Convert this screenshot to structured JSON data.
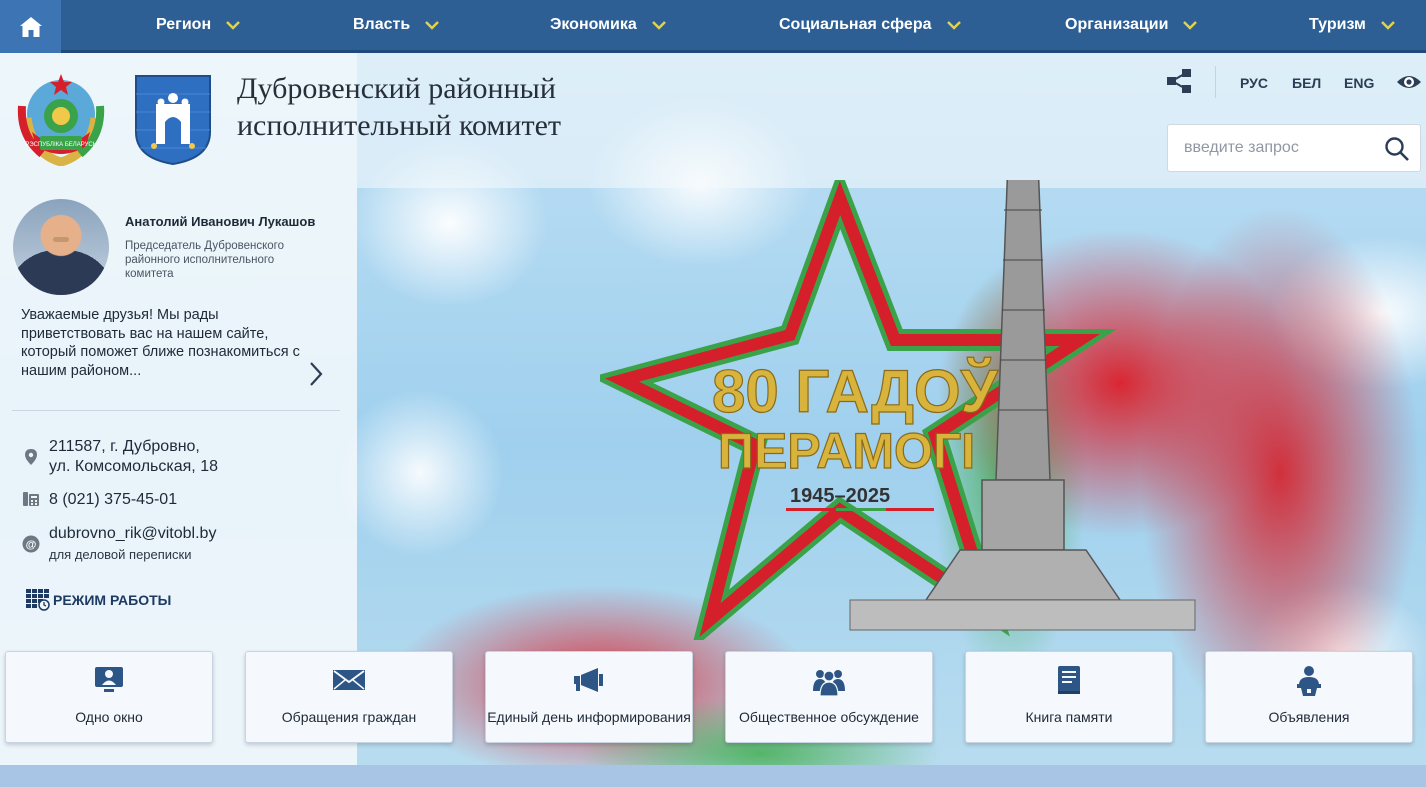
{
  "nav": {
    "items": [
      {
        "label": "Регион"
      },
      {
        "label": "Власть"
      },
      {
        "label": "Экономика"
      },
      {
        "label": "Социальная сфера"
      },
      {
        "label": "Организации"
      },
      {
        "label": "Туризм"
      }
    ]
  },
  "header": {
    "title_line1": "Дубровенский районный",
    "title_line2": "исполнительный комитет",
    "emblem_text": "РЭСПУБЛІКА БЕЛАРУСЬ",
    "languages": [
      "РУС",
      "БЕЛ",
      "ENG"
    ],
    "search_placeholder": "введите запрос"
  },
  "chairman": {
    "name": "Анатолий Иванович Лукашов",
    "role": "Председатель Дубровенского районного исполнительного комитета",
    "greeting": "Уважаемые друзья! Мы рады приветствовать вас на нашем сайте, который поможет ближе познакомиться с нашим районом..."
  },
  "contacts": {
    "address_line1": "211587, г. Дубровно,",
    "address_line2": "ул. Комсомольская, 18",
    "phone": "8 (021) 375-45-01",
    "email": "dubrovno_rik@vitobl.by",
    "email_note": "для деловой переписки",
    "work_mode": "РЕЖИМ РАБОТЫ"
  },
  "banner": {
    "line1": "80 ГАДОЎ",
    "line2": "ПЕРАМОГІ",
    "years": "1945–2025"
  },
  "tiles": [
    {
      "label": "Одно окно",
      "icon": "monitor-user-icon"
    },
    {
      "label": "Обращения граждан",
      "icon": "envelope-icon"
    },
    {
      "label": "Единый день информирования",
      "icon": "megaphone-icon"
    },
    {
      "label": "Общественное обсуждение",
      "icon": "people-group-icon"
    },
    {
      "label": "Книга памяти",
      "icon": "book-icon"
    },
    {
      "label": "Объявления",
      "icon": "speaker-podium-icon"
    }
  ],
  "colors": {
    "nav_bg": "#2d5f95",
    "home_bg": "#3d75b4",
    "accent_yellow": "#e2d24a",
    "icon_blue": "#2d5585",
    "flag_red": "#d51f2a",
    "flag_green": "#3aa34a"
  }
}
